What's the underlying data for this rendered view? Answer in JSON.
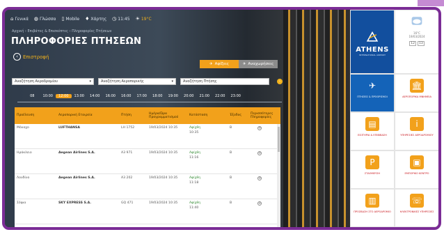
{
  "nav": {
    "items": [
      {
        "icon": "home-icon",
        "label": "Γενικά"
      },
      {
        "icon": "globe-icon",
        "label": "Γλώσσα"
      },
      {
        "icon": "mobile-icon",
        "label": "Mobile"
      },
      {
        "icon": "map-pin-icon",
        "label": "Χάρτης"
      },
      {
        "icon": "clock-icon",
        "label": "11:45"
      },
      {
        "icon": "weather-icon",
        "label": "19°C"
      }
    ]
  },
  "breadcrumb": [
    "Αρχική",
    "Επιβάτες & Επισκέπτες",
    "Πληροφορίες Πτήσεων"
  ],
  "page_title": "ΠΛΗΡΟΦΟΡΙΕΣ ΠΤΗΣΕΩΝ",
  "back_label": "Επιστροφή",
  "direction_tabs": {
    "arrivals": "Αφίξεις",
    "departures": "Αναχωρήσεις"
  },
  "filters": {
    "airport_from": "Αναζήτηση Αεροδρομίου",
    "airline": "Αναζήτηση Αεροπορικής",
    "flight": "Αναζήτηση Πτήσης"
  },
  "time_slots": [
    "08",
    "10:00",
    "12:00",
    "13:00",
    "14:00",
    "16:00",
    "16:00",
    "17:00",
    "18:00",
    "19:00",
    "20:00",
    "21:00",
    "22:00",
    "23:00"
  ],
  "active_time_index": 2,
  "table": {
    "headers": [
      "Προέλευση",
      "Αεροπορική Εταιρεία",
      "Πτήση",
      "Ημέρα/Ώρα Προγραμματισμού",
      "Κατάσταση",
      "Έξοδος",
      "Περισσότερες Πληροφορίες"
    ],
    "rows": [
      {
        "origin": "Μόναχο",
        "airline": "LUFTHANSA",
        "flight": "LH 1752",
        "sched": "19/03/2024 10:35",
        "status": "Αφίχθη",
        "status_time": "10:35",
        "exit": "B"
      },
      {
        "origin": "Ηράκλειο",
        "airline": "Aegean Airlines S.A.",
        "flight": "A3 971",
        "sched": "19/03/2024 10:35",
        "status": "Αφίχθη",
        "status_time": "11:16",
        "exit": "B"
      },
      {
        "origin": "Λονδίνο",
        "airline": "Aegean Airlines S.A.",
        "flight": "A3 202",
        "sched": "19/03/2024 10:35",
        "status": "Αφίχθη",
        "status_time": "11:18",
        "exit": "B"
      },
      {
        "origin": "Σόφια",
        "airline": "SKY EXPRESS S.A.",
        "flight": "GQ 471",
        "sched": "19/03/2024 10:35",
        "status": "Αφίχθη",
        "status_time": "11:40",
        "exit": "B"
      }
    ]
  },
  "sidebar": {
    "logo_name": "ATHENS",
    "logo_sub": "INTERNATIONAL AIRPORT",
    "weather_temp": "16°C",
    "weather_date": "19/03/2024",
    "weather_cells": [
      "12",
      "13"
    ],
    "tiles": [
      {
        "icon": "plane-icon",
        "label": "ΠΤΗΣΕΙΣ & ΠΡΟΟΡΙΣΜΟΙ"
      },
      {
        "icon": "museum-icon",
        "label": "ΑΕΡΟΠΟΡΙΚΑ ΜΝΗΜΕΙΑ"
      },
      {
        "icon": "ticket-icon",
        "label": "ΕΙΣΙΤΗΡΙΑ & ΕΠΙΒΙΒΑΣΗ"
      },
      {
        "icon": "info-icon",
        "label": "ΥΠΗΡΕΣΙΕΣ ΑΕΡΟΔΡΟΜΙΟΥ"
      },
      {
        "icon": "parking-icon",
        "label": "ΣΤΑΘΜΕΥΣΗ"
      },
      {
        "icon": "shopping-bag-icon",
        "label": "ΕΜΠΟΡΙΚΟ ΚΕΝΤΡΟ"
      },
      {
        "icon": "bus-icon",
        "label": "ΠΡΟΣΒΑΣΗ ΣΤΟ ΑΕΡΟΔΡΟΜΙΟ"
      },
      {
        "icon": "phone-icon",
        "label": "ΗΛΕΚΤΡΟΝΙΚΕΣ ΥΠΗΡΕΣΙΕΣ"
      }
    ]
  },
  "colors": {
    "frame": "#7b2c96",
    "accent": "#f2a11b",
    "brand_blue": "#124f9e",
    "tile_label": "#c8141b"
  }
}
